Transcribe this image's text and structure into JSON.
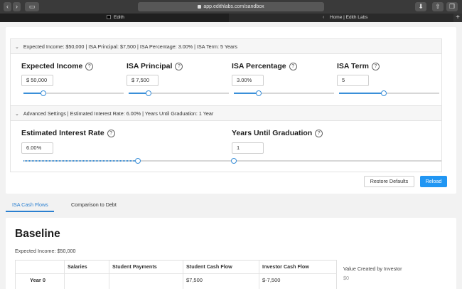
{
  "browser": {
    "url": "app.edithlabs.com/sandbox",
    "tabs": [
      {
        "label": "Edith"
      },
      {
        "label": "Home | Edith Labs"
      }
    ]
  },
  "assumptions": {
    "summary": "Expected Income: $50,000 | ISA Principal: $7,500 | ISA Percentage: 3.00% | ISA Term: 5 Years",
    "fields": [
      {
        "label": "Expected Income",
        "value": "$ 50,000",
        "slider_fraction": 0.2
      },
      {
        "label": "ISA Principal",
        "value": "$ 7,500",
        "slider_fraction": 0.2
      },
      {
        "label": "ISA Percentage",
        "value": "3.00%",
        "slider_fraction": 0.25
      },
      {
        "label": "ISA Term",
        "value": "5",
        "slider_fraction": 0.45
      }
    ]
  },
  "advanced": {
    "summary": "Advanced Settings | Estimated Interest Rate: 6.00% | Years Until Graduation: 1 Year",
    "fields": [
      {
        "label": "Estimated Interest Rate",
        "value": "6.00%",
        "slider_fraction": 0.55
      },
      {
        "label": "Years Until Graduation",
        "value": "1",
        "slider_fraction": 0.0
      }
    ]
  },
  "buttons": {
    "restore": "Restore Defaults",
    "reload": "Reload"
  },
  "nav": {
    "tabs": [
      "ISA Cash Flows",
      "Comparison to Debt"
    ]
  },
  "baseline": {
    "title": "Baseline",
    "subtitle": "Expected Income: $50,000",
    "table": {
      "headers": [
        "",
        "Salaries",
        "Student Payments",
        "Student Cash Flow",
        "Investor Cash Flow"
      ],
      "rows": [
        [
          "Year 0",
          "",
          "",
          "$7,500",
          "$-7,500"
        ]
      ]
    },
    "side_title": "Value Created by Investor",
    "side_value": "$0"
  },
  "colors": {
    "accent": "#2196f3",
    "link": "#2a7fd0"
  }
}
